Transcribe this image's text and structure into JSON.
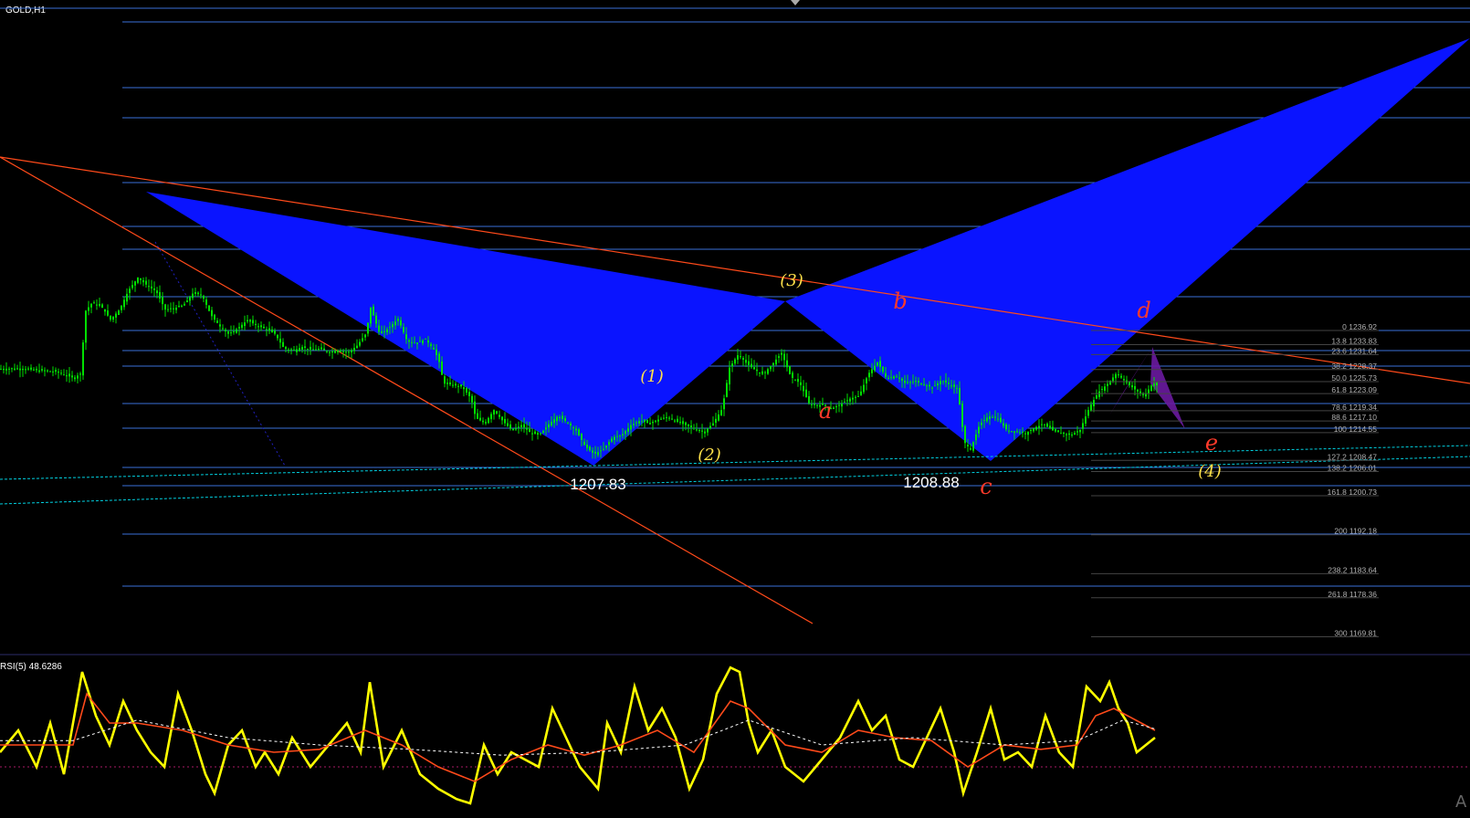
{
  "header": {
    "symbol": "GOLD,H1"
  },
  "rsi_panel": {
    "label": "RSI(5) 48.6286",
    "corner_text": "A"
  },
  "colors": {
    "background": "#000000",
    "level_line": "#3a6fd8",
    "wedge_fill": "#0a14ff",
    "trendline": "#ff4a1a",
    "candle": "#00e000",
    "fib_text": "#b0b0b0",
    "wave_label_yellow": "#ffe24a",
    "wave_label_red": "#ff3a2a",
    "rsi_main": "#ffff00",
    "rsi_signal": "#ff4a1a",
    "rsi_dashed": "#ffffff",
    "cyan_dotted": "#00d0e0",
    "purple_fill": "#6a1aa0",
    "rsi_mid_line": "#aa1a66"
  },
  "chart_data": {
    "type": "candlestick",
    "symbol": "GOLD",
    "timeframe": "H1",
    "ylim": [
      1165,
      1250
    ],
    "price_labels": [
      {
        "text": "1207.83",
        "value": 1207.83
      },
      {
        "text": "1208.88",
        "value": 1208.88
      }
    ],
    "wave_labels": [
      {
        "text": "(1)",
        "color": "yellow"
      },
      {
        "text": "(2)",
        "color": "yellow"
      },
      {
        "text": "(3)",
        "color": "yellow"
      },
      {
        "text": "(4)",
        "color": "yellow"
      },
      {
        "text": "a",
        "color": "red"
      },
      {
        "text": "b",
        "color": "red"
      },
      {
        "text": "c",
        "color": "red"
      },
      {
        "text": "d",
        "color": "red"
      },
      {
        "text": "e",
        "color": "red"
      }
    ],
    "fib_levels": [
      {
        "pct": "0",
        "price": "1236.92"
      },
      {
        "pct": "13.8",
        "price": "1233.83"
      },
      {
        "pct": "23.6",
        "price": "1231.64"
      },
      {
        "pct": "38.2",
        "price": "1228.37"
      },
      {
        "pct": "50.0",
        "price": "1225.73"
      },
      {
        "pct": "61.8",
        "price": "1223.09"
      },
      {
        "pct": "78.6",
        "price": "1219.34"
      },
      {
        "pct": "88.6",
        "price": "1217.10"
      },
      {
        "pct": "100",
        "price": "1214.55"
      },
      {
        "pct": "127.2",
        "price": "1208.47"
      },
      {
        "pct": "138.2",
        "price": "1206.01"
      },
      {
        "pct": "161.8",
        "price": "1200.73"
      },
      {
        "pct": "200",
        "price": "1192.18"
      },
      {
        "pct": "238.2",
        "price": "1183.64"
      },
      {
        "pct": "261.8",
        "price": "1178.36"
      },
      {
        "pct": "300",
        "price": "1169.81"
      }
    ],
    "close_path": [
      [
        0,
        1228.5
      ],
      [
        20,
        1228.6
      ],
      [
        40,
        1228.2
      ],
      [
        60,
        1227.9
      ],
      [
        80,
        1226.5
      ],
      [
        88,
        1227.6
      ],
      [
        92,
        1241.0
      ],
      [
        100,
        1243.0
      ],
      [
        110,
        1242.2
      ],
      [
        120,
        1239.3
      ],
      [
        130,
        1241.5
      ],
      [
        140,
        1245.8
      ],
      [
        150,
        1248.5
      ],
      [
        160,
        1246.8
      ],
      [
        170,
        1245.5
      ],
      [
        180,
        1241.5
      ],
      [
        190,
        1241.8
      ],
      [
        200,
        1242.5
      ],
      [
        210,
        1245.0
      ],
      [
        220,
        1244.8
      ],
      [
        230,
        1240.3
      ],
      [
        240,
        1237.8
      ],
      [
        250,
        1236.0
      ],
      [
        260,
        1237.5
      ],
      [
        270,
        1239.2
      ],
      [
        280,
        1238.0
      ],
      [
        290,
        1237.3
      ],
      [
        300,
        1236.2
      ],
      [
        310,
        1233.0
      ],
      [
        320,
        1232.5
      ],
      [
        330,
        1233.3
      ],
      [
        340,
        1232.7
      ],
      [
        350,
        1232.9
      ],
      [
        360,
        1232.2
      ],
      [
        370,
        1232.6
      ],
      [
        380,
        1232.0
      ],
      [
        390,
        1233.6
      ],
      [
        400,
        1236.3
      ],
      [
        405,
        1242.0
      ],
      [
        415,
        1236.0
      ],
      [
        425,
        1237.5
      ],
      [
        435,
        1239.5
      ],
      [
        445,
        1234.5
      ],
      [
        455,
        1234.2
      ],
      [
        465,
        1235.0
      ],
      [
        475,
        1232.5
      ],
      [
        480,
        1230.0
      ],
      [
        485,
        1225.3
      ],
      [
        495,
        1225.0
      ],
      [
        505,
        1224.6
      ],
      [
        515,
        1222.0
      ],
      [
        520,
        1217.8
      ],
      [
        530,
        1216.6
      ],
      [
        540,
        1219.5
      ],
      [
        550,
        1217.0
      ],
      [
        560,
        1215.0
      ],
      [
        570,
        1216.2
      ],
      [
        580,
        1214.5
      ],
      [
        590,
        1214.0
      ],
      [
        600,
        1216.4
      ],
      [
        610,
        1218.2
      ],
      [
        620,
        1216.8
      ],
      [
        630,
        1215.0
      ],
      [
        640,
        1211.5
      ],
      [
        650,
        1209.8
      ],
      [
        660,
        1211.0
      ],
      [
        670,
        1213.5
      ],
      [
        680,
        1214.0
      ],
      [
        690,
        1216.2
      ],
      [
        700,
        1217.2
      ],
      [
        710,
        1216.6
      ],
      [
        720,
        1217.4
      ],
      [
        730,
        1218.0
      ],
      [
        740,
        1217.0
      ],
      [
        750,
        1216.2
      ],
      [
        760,
        1215.4
      ],
      [
        770,
        1214.6
      ],
      [
        780,
        1216.6
      ],
      [
        790,
        1219.8
      ],
      [
        798,
        1228.8
      ],
      [
        808,
        1231.8
      ],
      [
        815,
        1230.0
      ],
      [
        825,
        1228.4
      ],
      [
        835,
        1227.3
      ],
      [
        845,
        1229.6
      ],
      [
        855,
        1232.0
      ],
      [
        865,
        1226.8
      ],
      [
        875,
        1225.4
      ],
      [
        885,
        1221.0
      ],
      [
        890,
        1220.6
      ],
      [
        900,
        1220.6
      ],
      [
        910,
        1219.8
      ],
      [
        920,
        1220.8
      ],
      [
        930,
        1222.0
      ],
      [
        940,
        1222.6
      ],
      [
        950,
        1227.4
      ],
      [
        960,
        1230.0
      ],
      [
        970,
        1226.4
      ],
      [
        980,
        1227.0
      ],
      [
        990,
        1225.4
      ],
      [
        1000,
        1225.8
      ],
      [
        1010,
        1225.2
      ],
      [
        1020,
        1224.4
      ],
      [
        1030,
        1226.0
      ],
      [
        1040,
        1225.0
      ],
      [
        1048,
        1224.0
      ],
      [
        1055,
        1212.5
      ],
      [
        1062,
        1210.8
      ],
      [
        1072,
        1216.4
      ],
      [
        1082,
        1218.2
      ],
      [
        1092,
        1217.6
      ],
      [
        1102,
        1215.0
      ],
      [
        1112,
        1214.8
      ],
      [
        1122,
        1214.4
      ],
      [
        1132,
        1215.6
      ],
      [
        1142,
        1216.4
      ],
      [
        1152,
        1215.0
      ],
      [
        1162,
        1214.4
      ],
      [
        1172,
        1214.0
      ],
      [
        1182,
        1215.2
      ],
      [
        1192,
        1220.0
      ],
      [
        1202,
        1223.4
      ],
      [
        1212,
        1225.2
      ],
      [
        1222,
        1227.6
      ],
      [
        1232,
        1225.6
      ],
      [
        1242,
        1224.0
      ],
      [
        1252,
        1222.6
      ],
      [
        1262,
        1225.4
      ],
      [
        1268,
        1224.6
      ]
    ],
    "rsi": {
      "label": "RSI(5)",
      "current_value": 48.6286,
      "ylim": [
        0,
        100
      ],
      "series": [
        {
          "name": "RSI(5)",
          "values": [
            [
              0,
              40
            ],
            [
              20,
              55
            ],
            [
              40,
              30
            ],
            [
              55,
              60
            ],
            [
              70,
              25
            ],
            [
              90,
              95
            ],
            [
              105,
              65
            ],
            [
              120,
              45
            ],
            [
              135,
              75
            ],
            [
              150,
              55
            ],
            [
              165,
              40
            ],
            [
              180,
              30
            ],
            [
              195,
              80
            ],
            [
              210,
              55
            ],
            [
              225,
              25
            ],
            [
              235,
              12
            ],
            [
              250,
              45
            ],
            [
              265,
              55
            ],
            [
              280,
              30
            ],
            [
              290,
              40
            ],
            [
              305,
              25
            ],
            [
              320,
              50
            ],
            [
              340,
              30
            ],
            [
              360,
              45
            ],
            [
              380,
              60
            ],
            [
              395,
              40
            ],
            [
              405,
              88
            ],
            [
              420,
              30
            ],
            [
              440,
              55
            ],
            [
              460,
              25
            ],
            [
              480,
              15
            ],
            [
              500,
              8
            ],
            [
              515,
              5
            ],
            [
              530,
              45
            ],
            [
              545,
              25
            ],
            [
              560,
              40
            ],
            [
              575,
              35
            ],
            [
              590,
              30
            ],
            [
              605,
              70
            ],
            [
              620,
              50
            ],
            [
              635,
              30
            ],
            [
              655,
              15
            ],
            [
              665,
              60
            ],
            [
              680,
              40
            ],
            [
              695,
              85
            ],
            [
              710,
              55
            ],
            [
              725,
              70
            ],
            [
              740,
              50
            ],
            [
              755,
              15
            ],
            [
              770,
              35
            ],
            [
              785,
              80
            ],
            [
              800,
              98
            ],
            [
              810,
              95
            ],
            [
              820,
              60
            ],
            [
              830,
              40
            ],
            [
              845,
              55
            ],
            [
              860,
              30
            ],
            [
              880,
              20
            ],
            [
              900,
              35
            ],
            [
              920,
              50
            ],
            [
              940,
              75
            ],
            [
              955,
              55
            ],
            [
              970,
              65
            ],
            [
              985,
              35
            ],
            [
              1000,
              30
            ],
            [
              1015,
              50
            ],
            [
              1030,
              70
            ],
            [
              1045,
              40
            ],
            [
              1055,
              12
            ],
            [
              1070,
              40
            ],
            [
              1085,
              70
            ],
            [
              1100,
              35
            ],
            [
              1115,
              40
            ],
            [
              1130,
              30
            ],
            [
              1145,
              65
            ],
            [
              1160,
              40
            ],
            [
              1175,
              30
            ],
            [
              1190,
              85
            ],
            [
              1205,
              75
            ],
            [
              1215,
              88
            ],
            [
              1225,
              70
            ],
            [
              1235,
              60
            ],
            [
              1245,
              40
            ],
            [
              1255,
              45
            ],
            [
              1265,
              50
            ]
          ]
        },
        {
          "name": "signal",
          "values": [
            [
              0,
              45
            ],
            [
              40,
              45
            ],
            [
              80,
              45
            ],
            [
              95,
              80
            ],
            [
              120,
              60
            ],
            [
              150,
              60
            ],
            [
              200,
              55
            ],
            [
              250,
              45
            ],
            [
              300,
              40
            ],
            [
              350,
              42
            ],
            [
              400,
              55
            ],
            [
              440,
              45
            ],
            [
              480,
              30
            ],
            [
              520,
              20
            ],
            [
              560,
              35
            ],
            [
              600,
              45
            ],
            [
              640,
              38
            ],
            [
              680,
              45
            ],
            [
              720,
              55
            ],
            [
              760,
              40
            ],
            [
              800,
              75
            ],
            [
              820,
              70
            ],
            [
              860,
              45
            ],
            [
              900,
              40
            ],
            [
              940,
              55
            ],
            [
              980,
              50
            ],
            [
              1020,
              48
            ],
            [
              1060,
              30
            ],
            [
              1100,
              45
            ],
            [
              1140,
              42
            ],
            [
              1180,
              45
            ],
            [
              1200,
              65
            ],
            [
              1220,
              70
            ],
            [
              1265,
              55
            ]
          ]
        },
        {
          "name": "dashed",
          "values": [
            [
              0,
              48
            ],
            [
              80,
              48
            ],
            [
              150,
              62
            ],
            [
              250,
              50
            ],
            [
              350,
              45
            ],
            [
              450,
              42
            ],
            [
              550,
              38
            ],
            [
              650,
              40
            ],
            [
              750,
              45
            ],
            [
              820,
              62
            ],
            [
              900,
              45
            ],
            [
              1000,
              50
            ],
            [
              1100,
              45
            ],
            [
              1180,
              48
            ],
            [
              1230,
              62
            ],
            [
              1265,
              56
            ]
          ]
        }
      ]
    }
  }
}
